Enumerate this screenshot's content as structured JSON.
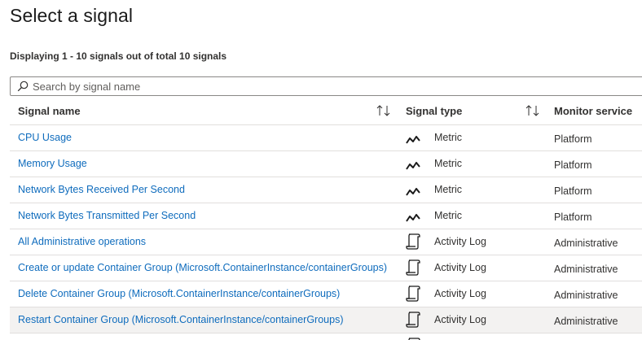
{
  "header": {
    "title": "Select a signal",
    "count_text": "Displaying 1 - 10 signals out of total 10 signals"
  },
  "search": {
    "placeholder": "Search by signal name",
    "value": "",
    "icon": "search-icon"
  },
  "columns": {
    "name": "Signal name",
    "type": "Signal type",
    "service": "Monitor service"
  },
  "rows": [
    {
      "name": "CPU Usage",
      "type": "Metric",
      "type_icon": "metric-icon",
      "service": "Platform"
    },
    {
      "name": "Memory Usage",
      "type": "Metric",
      "type_icon": "metric-icon",
      "service": "Platform"
    },
    {
      "name": "Network Bytes Received Per Second",
      "type": "Metric",
      "type_icon": "metric-icon",
      "service": "Platform"
    },
    {
      "name": "Network Bytes Transmitted Per Second",
      "type": "Metric",
      "type_icon": "metric-icon",
      "service": "Platform"
    },
    {
      "name": "All Administrative operations",
      "type": "Activity Log",
      "type_icon": "activity-log-icon",
      "service": "Administrative"
    },
    {
      "name": "Create or update Container Group (Microsoft.ContainerInstance/containerGroups)",
      "type": "Activity Log",
      "type_icon": "activity-log-icon",
      "service": "Administrative"
    },
    {
      "name": "Delete Container Group (Microsoft.ContainerInstance/containerGroups)",
      "type": "Activity Log",
      "type_icon": "activity-log-icon",
      "service": "Administrative"
    },
    {
      "name": "Restart Container Group (Microsoft.ContainerInstance/containerGroups)",
      "type": "Activity Log",
      "type_icon": "activity-log-icon",
      "service": "Administrative"
    }
  ],
  "colors": {
    "link": "#0f6cbd",
    "selected_row": "#f3f2f1",
    "border": "#e1dfdd"
  }
}
